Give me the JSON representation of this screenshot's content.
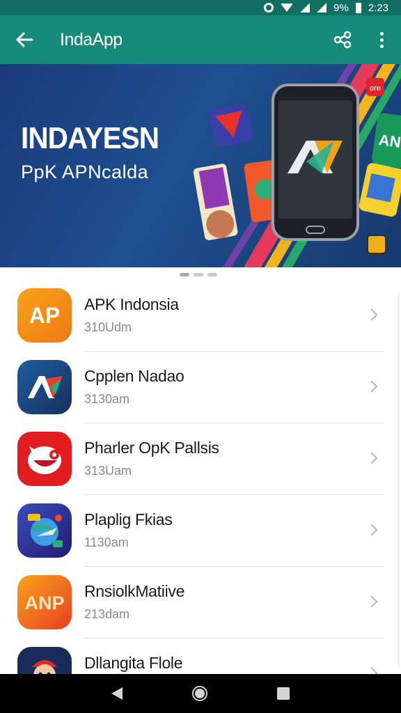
{
  "status_bar": {
    "battery": "9%",
    "time": "2:23"
  },
  "app_bar": {
    "title": "IndaApp"
  },
  "banner": {
    "title": "INDAYESN",
    "subtitle": "PpK APNcalda"
  },
  "apps": [
    {
      "name": "APK Indonsia",
      "meta": "310Udm",
      "icon": "ap-logo-icon",
      "color": "#f29418",
      "label": "AP"
    },
    {
      "name": "Cpplen Nadao",
      "meta": "3130am",
      "icon": "av-logo-icon",
      "color": "#1f4f82",
      "label": "AV"
    },
    {
      "name": "Pharler OpK Pallsis",
      "meta": "313Uam",
      "icon": "red-mascot-icon",
      "color": "#e11d1d",
      "label": ""
    },
    {
      "name": "Plaplig Fkias",
      "meta": "1130am",
      "icon": "rocket-globe-icon",
      "color": "#2a3fa0",
      "label": ""
    },
    {
      "name": "RnsiolkMatiive",
      "meta": "213dam",
      "icon": "anp-logo-icon",
      "color": "#ef4a23",
      "label": "ANP"
    },
    {
      "name": "Dllangita Flole",
      "meta": "",
      "icon": "character-icon",
      "color": "#1b2c5c",
      "label": ""
    }
  ]
}
